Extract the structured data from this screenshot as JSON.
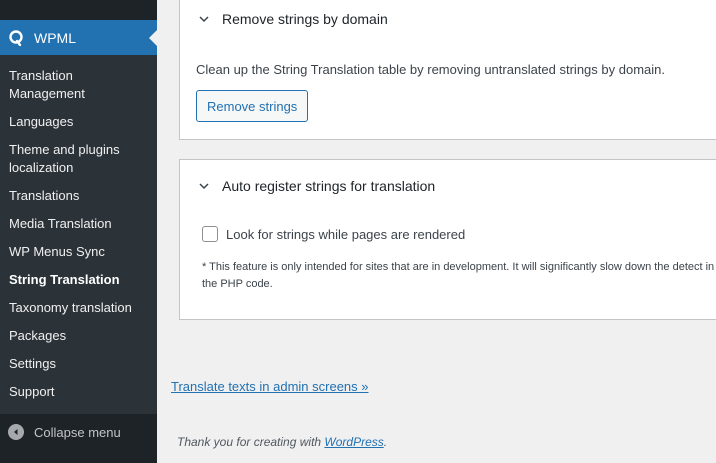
{
  "sidebar": {
    "active_label": "WPML",
    "items": [
      {
        "label": "Translation Management"
      },
      {
        "label": "Languages"
      },
      {
        "label": "Theme and plugins localization"
      },
      {
        "label": "Translations"
      },
      {
        "label": "Media Translation"
      },
      {
        "label": "WP Menus Sync"
      },
      {
        "label": "String Translation",
        "current": true
      },
      {
        "label": "Taxonomy translation"
      },
      {
        "label": "Packages"
      },
      {
        "label": "Settings"
      },
      {
        "label": "Support"
      }
    ],
    "collapse_label": "Collapse menu"
  },
  "remove_strings": {
    "title": "Remove strings by domain",
    "description": "Clean up the String Translation table by removing untranslated strings by domain.",
    "button_label": "Remove strings"
  },
  "auto_register": {
    "title": "Auto register strings for translation",
    "checkbox_label": "Look for strings while pages are rendered",
    "note": "* This feature is only intended for sites that are in development. It will significantly slow down the detect in the PHP code."
  },
  "admin_link": "Translate texts in admin screens »",
  "footer": {
    "text": "Thank you for creating with ",
    "link": "WordPress",
    "suffix": "."
  },
  "colors": {
    "sidebar_bg": "#1d2327",
    "submenu_bg": "#2c3338",
    "accent": "#2271b1"
  }
}
